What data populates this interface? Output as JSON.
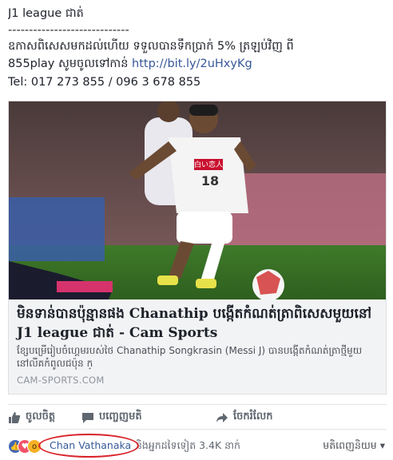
{
  "post": {
    "title": "J1 league ជាត់",
    "divider": "-----------------------------",
    "line2": "ឧកាសពិសេសមកដល់ហើយ ទទួលបានទឹកប្រាក់ 5% ត្រឡប់វិញ ពី",
    "line3_prefix": "855play សូមចូលទៅកាន់ ",
    "link": "http://bit.ly/2uHxyKg",
    "phone": "Tel: 017 273 855 / 096 3 678 855"
  },
  "card": {
    "image_alt": "Chanathip",
    "jersey_text": "白い恋人",
    "jersey_number": "18",
    "title": "មិនទាន់បានប៉ុន្មានផង Chanathip បង្កើតកំណត់ត្រាពិសេសមួយនៅ J1 league ជាត់ - Cam Sports",
    "description": "ខ្សែបម្រើរៀបចំហ្គេមរបស់ថៃ Chanathip Songkrasin  (Messi J) បានបង្កើតកំណត់ត្រាថ្មីមួយ នៅលីគកំពូលជប៉ុន ក្",
    "domain": "CAM-SPORTS.COM"
  },
  "actions": {
    "like": "ចូលចិត្ត",
    "comment": "បញ្ចេញមតិ",
    "share": "ចែករំលែក"
  },
  "reactions": {
    "name": "Chan Vathanaka",
    "others": "និងអ្នកដទៃទៀត 3.4K នាក់",
    "sort": "មតិពេញនិយម",
    "colors": {
      "like": "#4267b2",
      "love": "#f25268",
      "wow": "#f7b125",
      "highlight": "#d9232a"
    }
  }
}
